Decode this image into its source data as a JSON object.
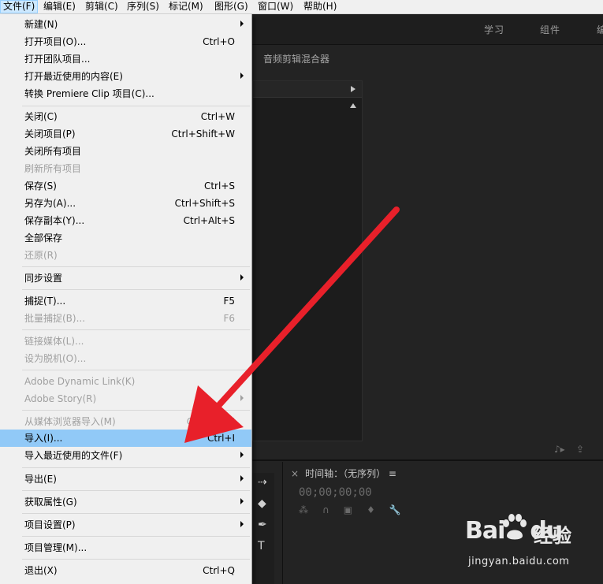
{
  "menubar": {
    "items": [
      {
        "label": "文件(F)",
        "active": true
      },
      {
        "label": "编辑(E)"
      },
      {
        "label": "剪辑(C)"
      },
      {
        "label": "序列(S)"
      },
      {
        "label": "标记(M)"
      },
      {
        "label": "图形(G)"
      },
      {
        "label": "窗口(W)"
      },
      {
        "label": "帮助(H)"
      }
    ]
  },
  "workspaces": [
    "学习",
    "组件",
    "编"
  ],
  "panel_header": "音频剪辑混合器",
  "file_menu": [
    {
      "label": "新建(N)",
      "submenu": true
    },
    {
      "label": "打开项目(O)...",
      "shortcut": "Ctrl+O"
    },
    {
      "label": "打开团队项目..."
    },
    {
      "label": "打开最近使用的内容(E)",
      "submenu": true
    },
    {
      "label": "转换 Premiere Clip 项目(C)..."
    },
    {
      "label": "关闭(C)",
      "shortcut": "Ctrl+W"
    },
    {
      "label": "关闭项目(P)",
      "shortcut": "Ctrl+Shift+W"
    },
    {
      "label": "关闭所有项目"
    },
    {
      "label": "刷新所有项目",
      "disabled": true
    },
    {
      "label": "保存(S)",
      "shortcut": "Ctrl+S"
    },
    {
      "label": "另存为(A)...",
      "shortcut": "Ctrl+Shift+S"
    },
    {
      "label": "保存副本(Y)...",
      "shortcut": "Ctrl+Alt+S"
    },
    {
      "label": "全部保存"
    },
    {
      "label": "还原(R)",
      "disabled": true
    },
    {
      "label": "同步设置",
      "submenu": true
    },
    {
      "label": "捕捉(T)...",
      "shortcut": "F5"
    },
    {
      "label": "批量捕捉(B)...",
      "shortcut": "F6",
      "disabled": true
    },
    {
      "label": "链接媒体(L)...",
      "disabled": true
    },
    {
      "label": "设为脱机(O)...",
      "disabled": true
    },
    {
      "label": "Adobe Dynamic Link(K)",
      "submenu": true,
      "disabled": true
    },
    {
      "label": "Adobe Story(R)",
      "submenu": true,
      "disabled": true
    },
    {
      "label": "从媒体浏览器导入(M)",
      "shortcut": "Ctrl+Alt+I",
      "disabled": true
    },
    {
      "label": "导入(I)...",
      "shortcut": "Ctrl+I",
      "highlighted": true
    },
    {
      "label": "导入最近使用的文件(F)",
      "submenu": true
    },
    {
      "label": "导出(E)",
      "submenu": true
    },
    {
      "label": "获取属性(G)",
      "submenu": true
    },
    {
      "label": "项目设置(P)",
      "submenu": true
    },
    {
      "label": "项目管理(M)..."
    },
    {
      "label": "退出(X)",
      "shortcut": "Ctrl+Q"
    }
  ],
  "timeline": {
    "close": "×",
    "title": "时间轴：（无序列）",
    "menu": "≡",
    "timecode": "00;00;00;00"
  },
  "watermark": {
    "logo": "Bai",
    "logo2": "du",
    "cn": "经验",
    "url": "jingyan.baidu.com"
  },
  "colors": {
    "menu_bg": "#f0f0f0",
    "highlight": "#91c9f7",
    "arrow": "#e8202a",
    "app_bg": "#232323"
  }
}
